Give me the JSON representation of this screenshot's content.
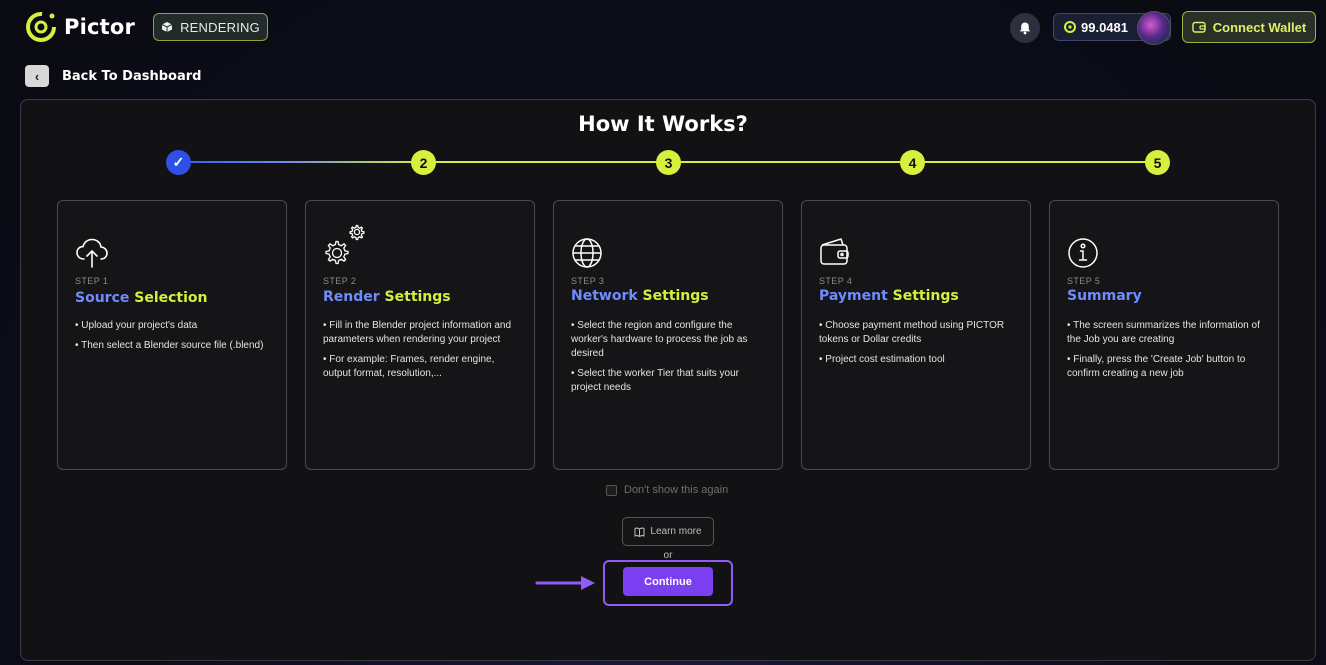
{
  "app": {
    "logo_text": "Pictor",
    "mode_badge": "RENDERING",
    "balance": "99.0481",
    "connect_wallet_label": "Connect Wallet"
  },
  "nav": {
    "back_label": "Back To Dashboard"
  },
  "page": {
    "title": "How It Works?"
  },
  "stepper": {
    "steps": [
      "✓",
      "2",
      "3",
      "4",
      "5"
    ]
  },
  "steps": [
    {
      "num": "STEP 1",
      "title_a": "Source ",
      "title_b": "Selection",
      "icon": "cloud-upload-icon",
      "bullets": [
        "Upload your project's data",
        "Then select a Blender source file (.blend)"
      ]
    },
    {
      "num": "STEP 2",
      "title_a": "Render ",
      "title_b": "Settings",
      "icon": "gears-icon",
      "bullets": [
        "Fill in the Blender project information and parameters when rendering your project",
        "For example: Frames, render engine, output format, resolution,..."
      ]
    },
    {
      "num": "STEP 3",
      "title_a": "Network ",
      "title_b": "Settings",
      "icon": "globe-icon",
      "bullets": [
        "Select the region and configure the worker's hardware to process the job as desired",
        "Select the worker Tier that suits your project needs"
      ]
    },
    {
      "num": "STEP 4",
      "title_a": "Payment ",
      "title_b": "Settings",
      "icon": "wallet-icon",
      "bullets": [
        "Choose payment method using PICTOR tokens or Dollar credits",
        "Project cost estimation tool"
      ]
    },
    {
      "num": "STEP 5",
      "title_a": "Summary",
      "title_b": "",
      "icon": "info-icon",
      "bullets": [
        "The screen summarizes the information of the Job you are creating",
        "Finally, press the 'Create Job' button to confirm creating a new job"
      ]
    }
  ],
  "footer": {
    "dont_show_label": "Don't show this again",
    "learn_more_label": "Learn more",
    "or_label": "or",
    "continue_label": "Continue"
  },
  "colors": {
    "accent_lime": "#d6ee3c",
    "accent_blue": "#6f8cff",
    "accent_purple": "#7b3ff2"
  }
}
